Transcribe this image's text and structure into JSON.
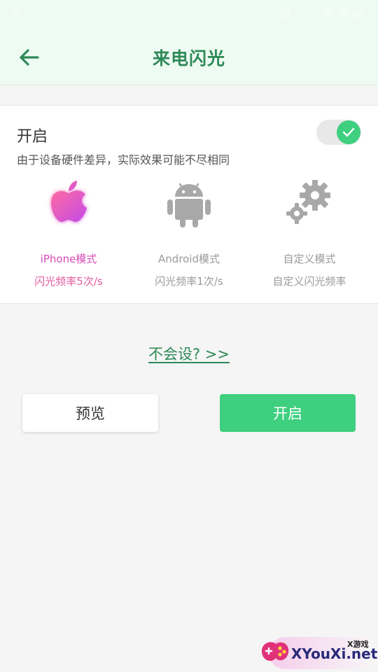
{
  "header": {
    "title": "来电闪光"
  },
  "enable_section": {
    "title": "开启",
    "description": "由于设备硬件差异，实际效果可能不尽相同",
    "toggle_on": true
  },
  "modes": [
    {
      "name": "iPhone模式",
      "desc": "闪光频率5次/s",
      "icon": "apple-icon",
      "selected": true
    },
    {
      "name": "Android模式",
      "desc": "闪光频率1次/s",
      "icon": "android-icon",
      "selected": false
    },
    {
      "name": "自定义模式",
      "desc": "自定义闪光频率",
      "icon": "gears-icon",
      "selected": false
    }
  ],
  "help_link": "不会设? >>",
  "buttons": {
    "preview": "预览",
    "enable": "开启"
  },
  "watermark": {
    "small": "X游戏",
    "main": "XYouXi.net"
  },
  "colors": {
    "accent": "#3ecf7f",
    "title_green": "#2e8a58",
    "header_bg": "#eefbf2",
    "selected_pink": "#d64bb9",
    "inactive_gray": "#9a9a9a"
  }
}
